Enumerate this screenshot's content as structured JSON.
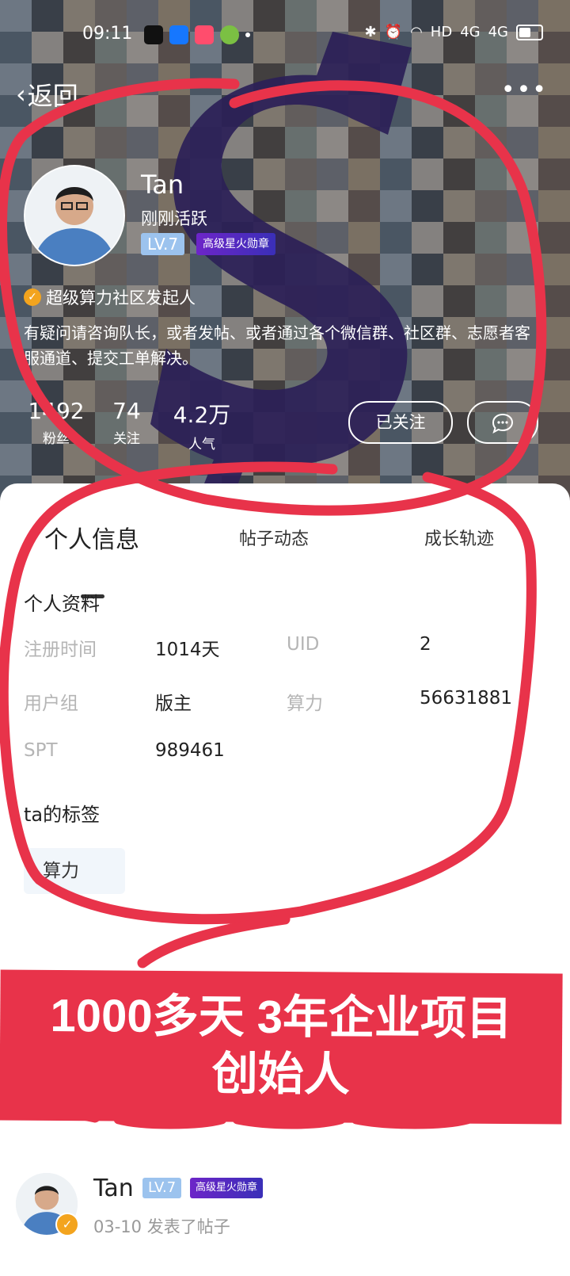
{
  "status_bar": {
    "time": "09:11",
    "network": "HD",
    "signal1": "4G",
    "signal2": "4G"
  },
  "nav": {
    "back_label": "返回",
    "more_label": "•••"
  },
  "profile": {
    "name": "Tan",
    "active_status": "刚刚活跃",
    "level": "LV.7",
    "medal": "高级星火勋章",
    "verified_title": "超级算力社区发起人",
    "bio": "有疑问请咨询队长，或者发帖、或者通过各个微信群、社区群、志愿者客服通道、提交工单解决。",
    "stats": [
      {
        "value": "1492",
        "label": "粉丝"
      },
      {
        "value": "74",
        "label": "关注"
      },
      {
        "value": "4.2万",
        "label": "人气"
      }
    ],
    "follow_button": "已关注"
  },
  "tabs": [
    {
      "label": "个人信息",
      "active": true
    },
    {
      "label": "帖子动态",
      "active": false
    },
    {
      "label": "成长轨迹",
      "active": false
    }
  ],
  "info": {
    "section_title": "个人资料",
    "fields": [
      {
        "key": "注册时间",
        "value": "1014天"
      },
      {
        "key": "UID",
        "value": "2"
      },
      {
        "key": "用户组",
        "value": "版主"
      },
      {
        "key": "算力",
        "value": "56631881"
      },
      {
        "key": "SPT",
        "value": "989461"
      }
    ],
    "tags_title": "ta的标签",
    "tags": [
      "算力"
    ]
  },
  "banner": {
    "line1": "1000多天  3年企业项目",
    "line2": "创始人"
  },
  "post": {
    "name": "Tan",
    "level": "LV.7",
    "medal": "高级星火勋章",
    "meta": "03-10 发表了帖子"
  },
  "colors": {
    "annotation_red": "#e8334a",
    "level_badge": "#9cc3ee",
    "medal_badge": "#5a2bc4",
    "verified_badge": "#f3a41e"
  }
}
